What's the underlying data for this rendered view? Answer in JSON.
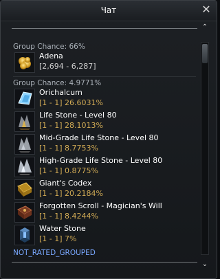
{
  "window": {
    "title": "Чат",
    "close_glyph": "✕",
    "scroll_up_glyph": "⌃",
    "scroll_down_glyph": "⌄"
  },
  "groups": [
    {
      "header": "Group Chance: 66%",
      "items": [
        {
          "name": "Adena",
          "value": "[2,694 - 6,287]",
          "icon": "adena-icon",
          "value_style": "neutral"
        }
      ]
    },
    {
      "header": "Group Chance: 4.9771%",
      "items": [
        {
          "name": "Orichalcum",
          "value": "[1 - 1] 26.6031%",
          "icon": "orichalcum-icon",
          "value_style": "gold"
        },
        {
          "name": "Life Stone - Level 80",
          "value": "[1 - 1] 28.1013%",
          "icon": "life-stone-icon",
          "value_style": "gold"
        },
        {
          "name": "Mid-Grade Life Stone - Level 80",
          "value": "[1 - 1] 8.7753%",
          "icon": "mid-grade-life-stone-icon",
          "value_style": "gold"
        },
        {
          "name": "High-Grade Life Stone - Level 80",
          "value": "[1 - 1] 0.8775%",
          "icon": "high-grade-life-stone-icon",
          "value_style": "gold"
        },
        {
          "name": "Giant's Codex",
          "value": "[1 - 1] 20.2184%",
          "icon": "giants-codex-icon",
          "value_style": "gold"
        },
        {
          "name": "Forgotten Scroll - Magician's Will",
          "value": "[1 - 1] 8.4244%",
          "icon": "forgotten-scroll-icon",
          "value_style": "gold"
        },
        {
          "name": "Water Stone",
          "value": "[1 - 1] 7%",
          "icon": "water-stone-icon",
          "value_style": "gold"
        }
      ]
    }
  ],
  "footer": {
    "label": "NOT_RATED_GROUPED"
  },
  "colors": {
    "value_gold": "#d2ab55",
    "footer_blue": "#7aa8ff"
  }
}
